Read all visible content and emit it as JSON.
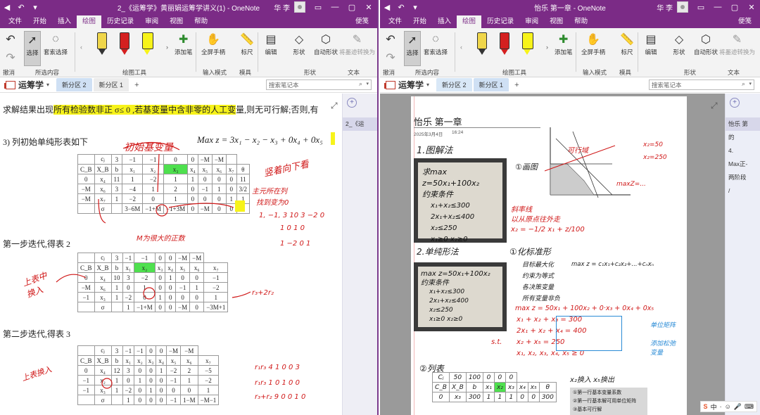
{
  "left": {
    "title": "2_《运筹学》黄丽娟运筹学讲义(1)  -  OneNote",
    "user": "华 李",
    "tabs": [
      "文件",
      "开始",
      "插入",
      "绘图",
      "历史记录",
      "审阅",
      "视图",
      "帮助"
    ],
    "active_tab": "绘图",
    "share_label": "便笺",
    "ribbon": {
      "undo": "撤消",
      "select": "选择",
      "lasso": "套索选择",
      "add_pen": "添加笔",
      "fullscreen_pen": "全屏手柄",
      "ruler": "标尺",
      "edit": "编辑",
      "shapes": "形状",
      "auto_shapes": "自动形状",
      "ink_to_math": "将墨迹转换为",
      "math_cut": "文本",
      "groups": {
        "selection": "所选内容",
        "tools": "绘图工具",
        "input": "输入模式",
        "stencils": "模具",
        "shapes": "形状",
        "text": "文本"
      }
    },
    "notebook": "运筹学",
    "sections": [
      "新分区 2",
      "新分区 1"
    ],
    "search_placeholder": "搜索笔记本",
    "page_list": [
      "2_《运"
    ],
    "text": {
      "line1_a": "求解结果出现",
      "line1_hl": "所有检验数非正 σ",
      "line1_b": "≤ 0 ,",
      "line1_hl2": "若基变量中含非零的人工变",
      "line1_c": "量,则无可行解;否则,有",
      "line2": "3) 列初始单纯形表如下",
      "objective": "Max z = 3x₁ − x₂ − x₃ + 0x₄ + 0x₅",
      "step1": "第一步迭代,得表 2",
      "step2": "第二步迭代,得表 3"
    },
    "table1": [
      [
        "",
        "cⱼ",
        "3",
        "−1",
        "−1",
        "0",
        "0",
        "−M",
        "−M",
        ""
      ],
      [
        "C_B",
        "X_B",
        "b",
        "x₁",
        "x₂",
        "x₃",
        "x₄",
        "x₅",
        "x₆",
        "x₇",
        "θ"
      ],
      [
        "0",
        "x₄",
        "11",
        "1",
        "−2",
        "1",
        "1",
        "0",
        "0",
        "0",
        "11"
      ],
      [
        "−M",
        "x₆",
        "3",
        "−4",
        "1",
        "2",
        "0",
        "−1",
        "1",
        "0",
        "3/2"
      ],
      [
        "−M",
        "x₇",
        "1",
        "−2",
        "0",
        "1",
        "0",
        "0",
        "0",
        "1",
        "1"
      ],
      [
        "",
        "σ",
        "",
        "3−6M",
        "−1+M",
        "−1+3M",
        "0",
        "−M",
        "0",
        "0",
        ""
      ]
    ],
    "table2": [
      [
        "",
        "cⱼ",
        "3",
        "−1",
        "−1",
        "0",
        "0",
        "−M",
        "−M"
      ],
      [
        "C_B",
        "X_B",
        "b",
        "x₁",
        "x₂",
        "x₃",
        "x₄",
        "x₅",
        "x₆",
        "x₇"
      ],
      [
        "0",
        "x₄",
        "10",
        "3",
        "−2",
        "0",
        "1",
        "0",
        "0",
        "−1"
      ],
      [
        "−M",
        "x₆",
        "1",
        "0",
        "1",
        "0",
        "0",
        "−1",
        "1",
        "−2"
      ],
      [
        "−1",
        "x₃",
        "1",
        "−2",
        "0",
        "1",
        "0",
        "0",
        "0",
        "1"
      ],
      [
        "",
        "σ",
        "",
        "1",
        "−1+M",
        "0",
        "0",
        "−M",
        "0",
        "−3M+1"
      ]
    ],
    "table3": [
      [
        "",
        "cⱼ",
        "3",
        "−1",
        "−1",
        "0",
        "0",
        "−M",
        "−M"
      ],
      [
        "C_B",
        "X_B",
        "b",
        "x₁",
        "x₂",
        "x₃",
        "x₄",
        "x₅",
        "x₆",
        "x₇"
      ],
      [
        "0",
        "x₄",
        "12",
        "3",
        "0",
        "0",
        "1",
        "−2",
        "2",
        "−5"
      ],
      [
        "−1",
        "x₂",
        "1",
        "0",
        "1",
        "0",
        "0",
        "−1",
        "1",
        "−2"
      ],
      [
        "−1",
        "x₃",
        "1",
        "−2",
        "0",
        "1",
        "0",
        "0",
        "0",
        "1"
      ],
      [
        "",
        "σ",
        "",
        "1",
        "0",
        "0",
        "0",
        "−1",
        "1−M",
        "−M−1"
      ]
    ],
    "ink": {
      "init_var": "初始基变量",
      "note_right": "竖着向下看",
      "main_col": "主元所在列",
      "find_pivot": "找到变为0",
      "rows": [
        "1, −1, 3  10   3  −2 0",
        "1  0  1  0",
        "1  −2  0  1"
      ],
      "m_note": "M为很大的正数",
      "swap_in": "上表中 换入",
      "r_note": "r₃+2r₂",
      "swap_in2": "上表换入",
      "r_rows": [
        "r₁r₃  4  1 0 0 3",
        "r₁r₃  1 0 1 0 0",
        "r₃+r₂  9 0 0 1 0"
      ]
    }
  },
  "right": {
    "title": "怡乐  第一章  -  OneNote",
    "user": "华 李",
    "tabs": [
      "文件",
      "开始",
      "插入",
      "绘图",
      "历史记录",
      "审阅",
      "视图",
      "帮助"
    ],
    "active_tab": "绘图",
    "share_label": "便笺",
    "notebook": "运筹学",
    "sections": [
      "新分区 2",
      "新分区 1"
    ],
    "search_placeholder": "搜索笔记本",
    "page_title": "怡乐  第一章",
    "date": "2025年3月4日",
    "time": "16:24",
    "page_list": [
      "怡乐 第",
      "的",
      "4.",
      "Max正-",
      "两阶段",
      "/"
    ],
    "ink": {
      "s1": "1.图解法",
      "s1b": "①画图",
      "graph_note": "可行域",
      "y": "x₂=50",
      "y2": "x₂=250",
      "maxline": "maxZ=...",
      "slope_note": "斜率线",
      "level_note": "以从原点往外走",
      "eq": "x₂ = −1/2 x₁ + z/100",
      "s2": "2.单纯形法",
      "std": "①化标准形",
      "steps": [
        "目标最大化",
        "约束为等式",
        "各决策变量",
        "所有变量非负"
      ],
      "max_eq": "max z = c₁x₁+c₂x₂+...+cₙxₙ",
      "max_z": "max z = 50x₁ + 100x₂ + 0·x₃ + 0x₄ + 0x₅",
      "st": "s.t.",
      "cons": [
        "x₁ + x₂ + x₃ = 300",
        "2x₁ + x₂ + x₄ = 400",
        "x₂ + x₅ = 250",
        "x₁, x₂, x₃, x₄, x₅ ≥ 0"
      ],
      "blue_note": "单位矩阵",
      "blue_note2": "添加松弛变量",
      "s3": "②列表",
      "cj_row": [
        "Cⱼ",
        "50",
        "100",
        "0",
        "0",
        "0"
      ],
      "head_row": [
        "C_B",
        "X_B",
        "b",
        "x₁",
        "x₂",
        "x₃",
        "x₄",
        "x₅",
        "θ"
      ],
      "row1": [
        "0",
        "x₃",
        "300",
        "1",
        "1",
        "1",
        "0",
        "0",
        "300"
      ],
      "in_out": "x₂换入  x₅换出"
    },
    "photo1": {
      "line1": "求max  z=50x₁+100x₂",
      "line2": "约束条件",
      "cons": [
        "x₁+x₂≤300",
        "2x₁+x₂≤400",
        "x₂≤250",
        "x₁≥0  x₂≥0"
      ]
    },
    "photo2": {
      "line1": "max  z=50x₁+100x₂",
      "line2": "约束条件",
      "cons": [
        "x₁+x₂≤300",
        "2x₁+x₂≤400",
        "x₂≤250",
        "x₁≥0  x₂≥0"
      ]
    },
    "sticky": [
      "①第一行基本变量系数",
      "②第一行基本解可用单位矩阵",
      "③基本可行解"
    ],
    "tray": [
      "中",
      "·",
      "☺"
    ]
  },
  "colors": {
    "accent": "#7b2b86",
    "highlight": "#f7f31a",
    "ink_red": "#d01818",
    "ink_blue": "#2a8bd6"
  }
}
